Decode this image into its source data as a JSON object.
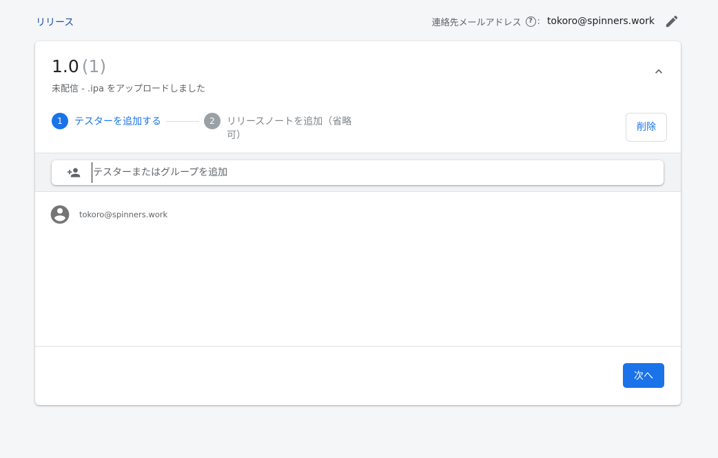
{
  "header": {
    "breadcrumb": "リリース",
    "contact_label": "連絡先メールアドレス",
    "contact_colon": ":",
    "contact_email": "tokoro@spinners.work"
  },
  "release": {
    "version": "1.0",
    "build_count": "(1)",
    "status": "未配信 - .ipa をアップロードしました"
  },
  "stepper": {
    "steps": [
      {
        "number": "1",
        "label": "テスターを追加する"
      },
      {
        "number": "2",
        "label": "リリースノートを追加（省略可）"
      }
    ]
  },
  "actions": {
    "delete_label": "削除",
    "next_label": "次へ"
  },
  "search": {
    "placeholder": "テスターまたはグループを追加",
    "value": ""
  },
  "testers": [
    {
      "email": "tokoro@spinners.work"
    }
  ],
  "icons": {
    "help": "help-circle-icon",
    "edit": "pencil-icon",
    "collapse": "chevron-up-icon",
    "add_person": "person-add-icon",
    "avatar": "account-circle-icon"
  },
  "colors": {
    "accent": "#1a73e8",
    "link": "#1a4fa0",
    "muted": "#9aa0a6"
  }
}
